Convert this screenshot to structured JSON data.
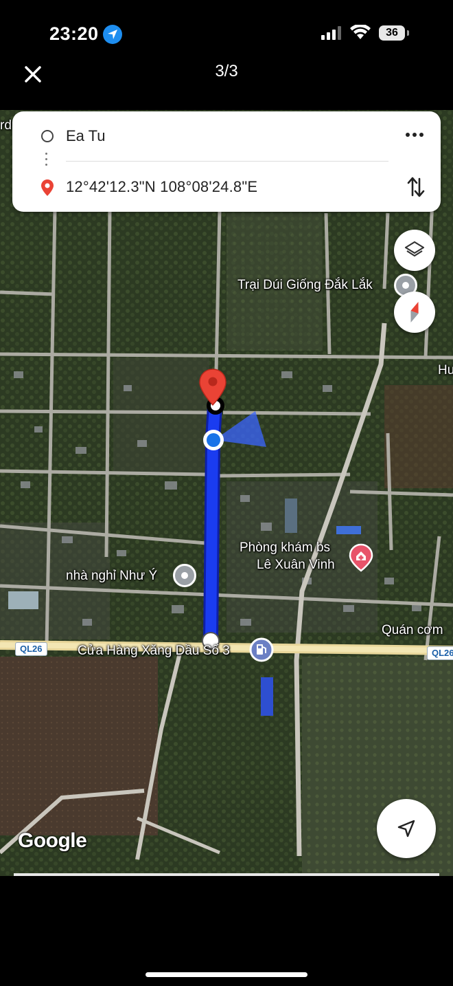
{
  "status_bar": {
    "time": "23:20",
    "battery": "36"
  },
  "viewer": {
    "page_counter": "3/3"
  },
  "route": {
    "origin": "Ea Tu",
    "destination": "12°42'12.3\"N 108°08'24.8\"E"
  },
  "map": {
    "labels": {
      "trai_dui": "Trại Dúi Giống Đắk Lắk",
      "phong_kham_line1": "Phòng khám bs",
      "phong_kham_line2": "Lê Xuân Vinh",
      "nha_nghi": "nhà nghỉ Như Ý",
      "quan_com": "Quán cơm",
      "cua_hang": "Cửa Hàng Xăng Dầu Số 3",
      "edge_hu": "Hu",
      "edge_rd": "rd",
      "highway_left": "QL26",
      "highway_right": "QL26"
    },
    "attribution": "Google",
    "colors": {
      "route": "#1a3cf0",
      "pin": "#ea4335",
      "user": "#1a73e8"
    },
    "icons": [
      "close-icon",
      "location-arrow-icon",
      "more-icon",
      "swap-icon",
      "layers-icon",
      "compass-icon",
      "navigate-icon",
      "gas-station-icon",
      "hospital-icon"
    ]
  }
}
